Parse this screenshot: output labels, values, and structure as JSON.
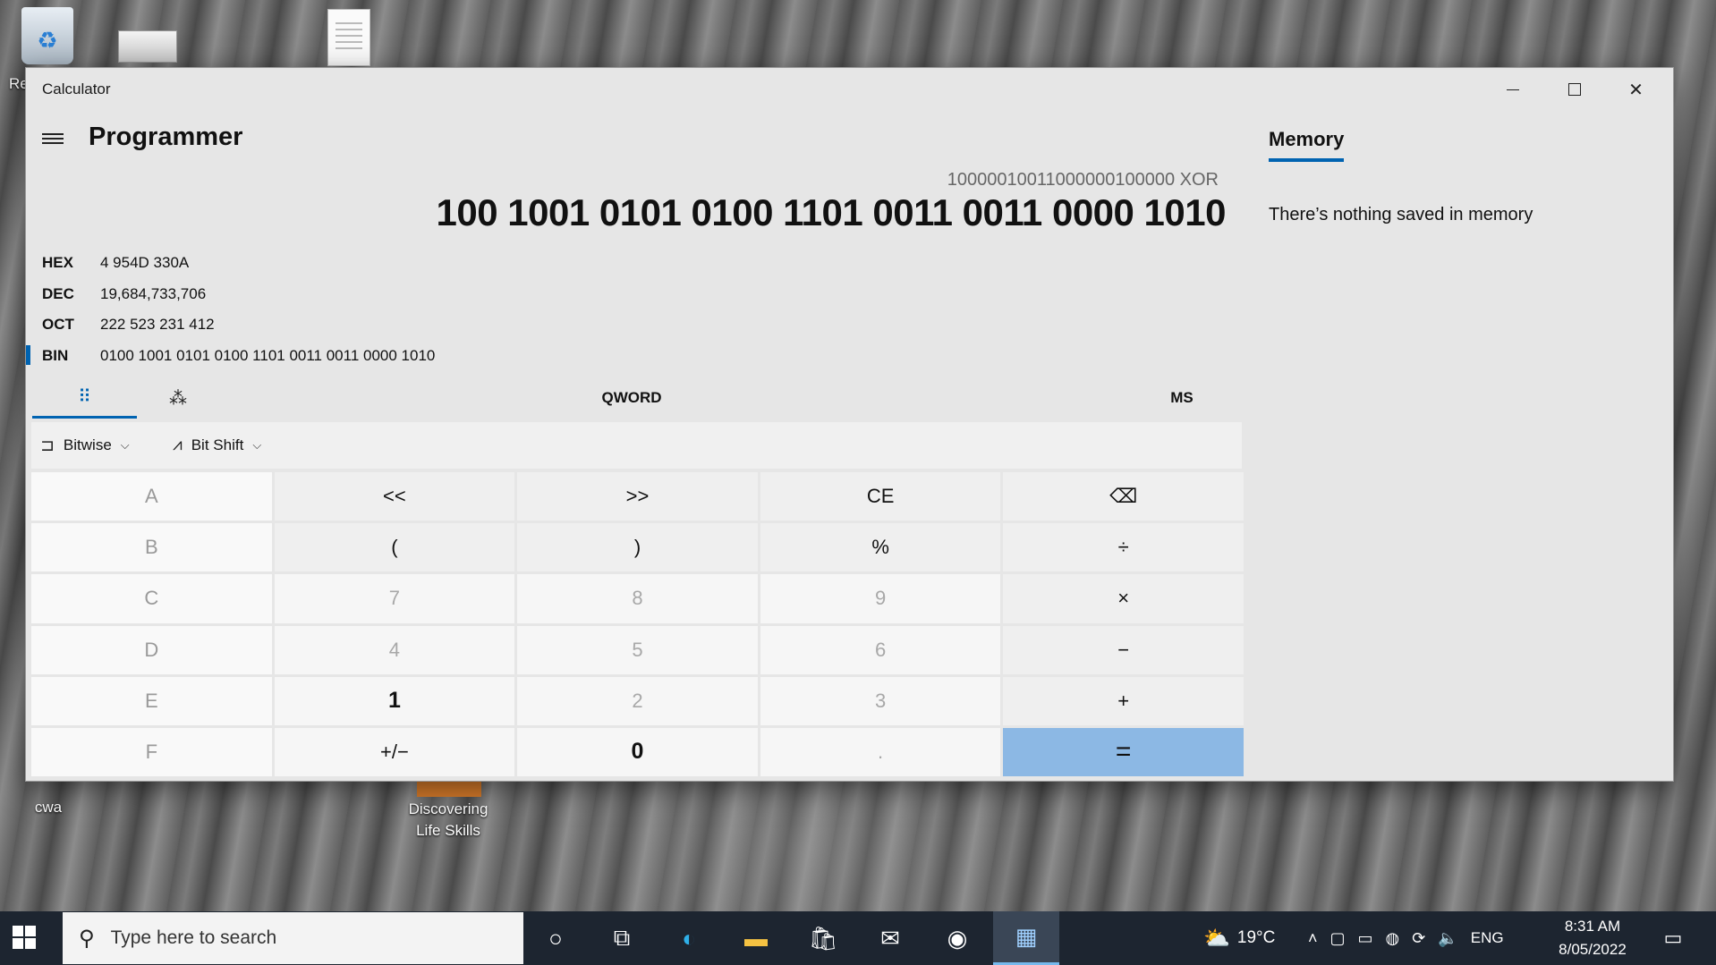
{
  "desktop": {
    "icons": {
      "recycle_partial_label": "Re",
      "cwa": "cwa",
      "life_skills": "Discovering Life Skills"
    }
  },
  "window": {
    "title": "Calculator",
    "controls": {
      "minimize": "minimize-icon",
      "maximize": "maximize-icon",
      "close": "close-icon"
    }
  },
  "calculator": {
    "mode": "Programmer",
    "expression": "10000010011000000100000 XOR",
    "result": "100 1001 0101 0100 1101 0011 0011 0000 1010",
    "radix": [
      {
        "name": "HEX",
        "value": "4 954D 330A"
      },
      {
        "name": "DEC",
        "value": "19,684,733,706"
      },
      {
        "name": "OCT",
        "value": "222 523 231 412"
      },
      {
        "name": "BIN",
        "value": "0100 1001 0101 0100 1101 0011 0011 0000 1010",
        "selected": true
      }
    ],
    "tabs": {
      "keypad_icon": "full-keypad-icon",
      "bits_icon": "bit-toggling-keypad-icon",
      "word_size": "QWORD",
      "memory_store": "MS"
    },
    "toolbar": {
      "bitwise": "Bitwise",
      "bitshift": "Bit Shift"
    },
    "keys": [
      [
        "A",
        "<<",
        ">>",
        "CE",
        "⌫"
      ],
      [
        "B",
        "(",
        ")",
        "%",
        "÷"
      ],
      [
        "C",
        "7",
        "8",
        "9",
        "×"
      ],
      [
        "D",
        "4",
        "5",
        "6",
        "−"
      ],
      [
        "E",
        "1",
        "2",
        "3",
        "+"
      ],
      [
        "F",
        "+/−",
        "0",
        ".",
        "="
      ]
    ]
  },
  "memory": {
    "tab": "Memory",
    "empty_message": "There’s nothing saved in memory"
  },
  "taskbar": {
    "search_placeholder": "Type here to search",
    "weather": "19°C",
    "language": "ENG",
    "time": "8:31 AM",
    "date": "8/05/2022"
  },
  "colors": {
    "accent": "#0063b1",
    "equals_key": "#8cb8e4",
    "taskbar": "#1d2530"
  }
}
